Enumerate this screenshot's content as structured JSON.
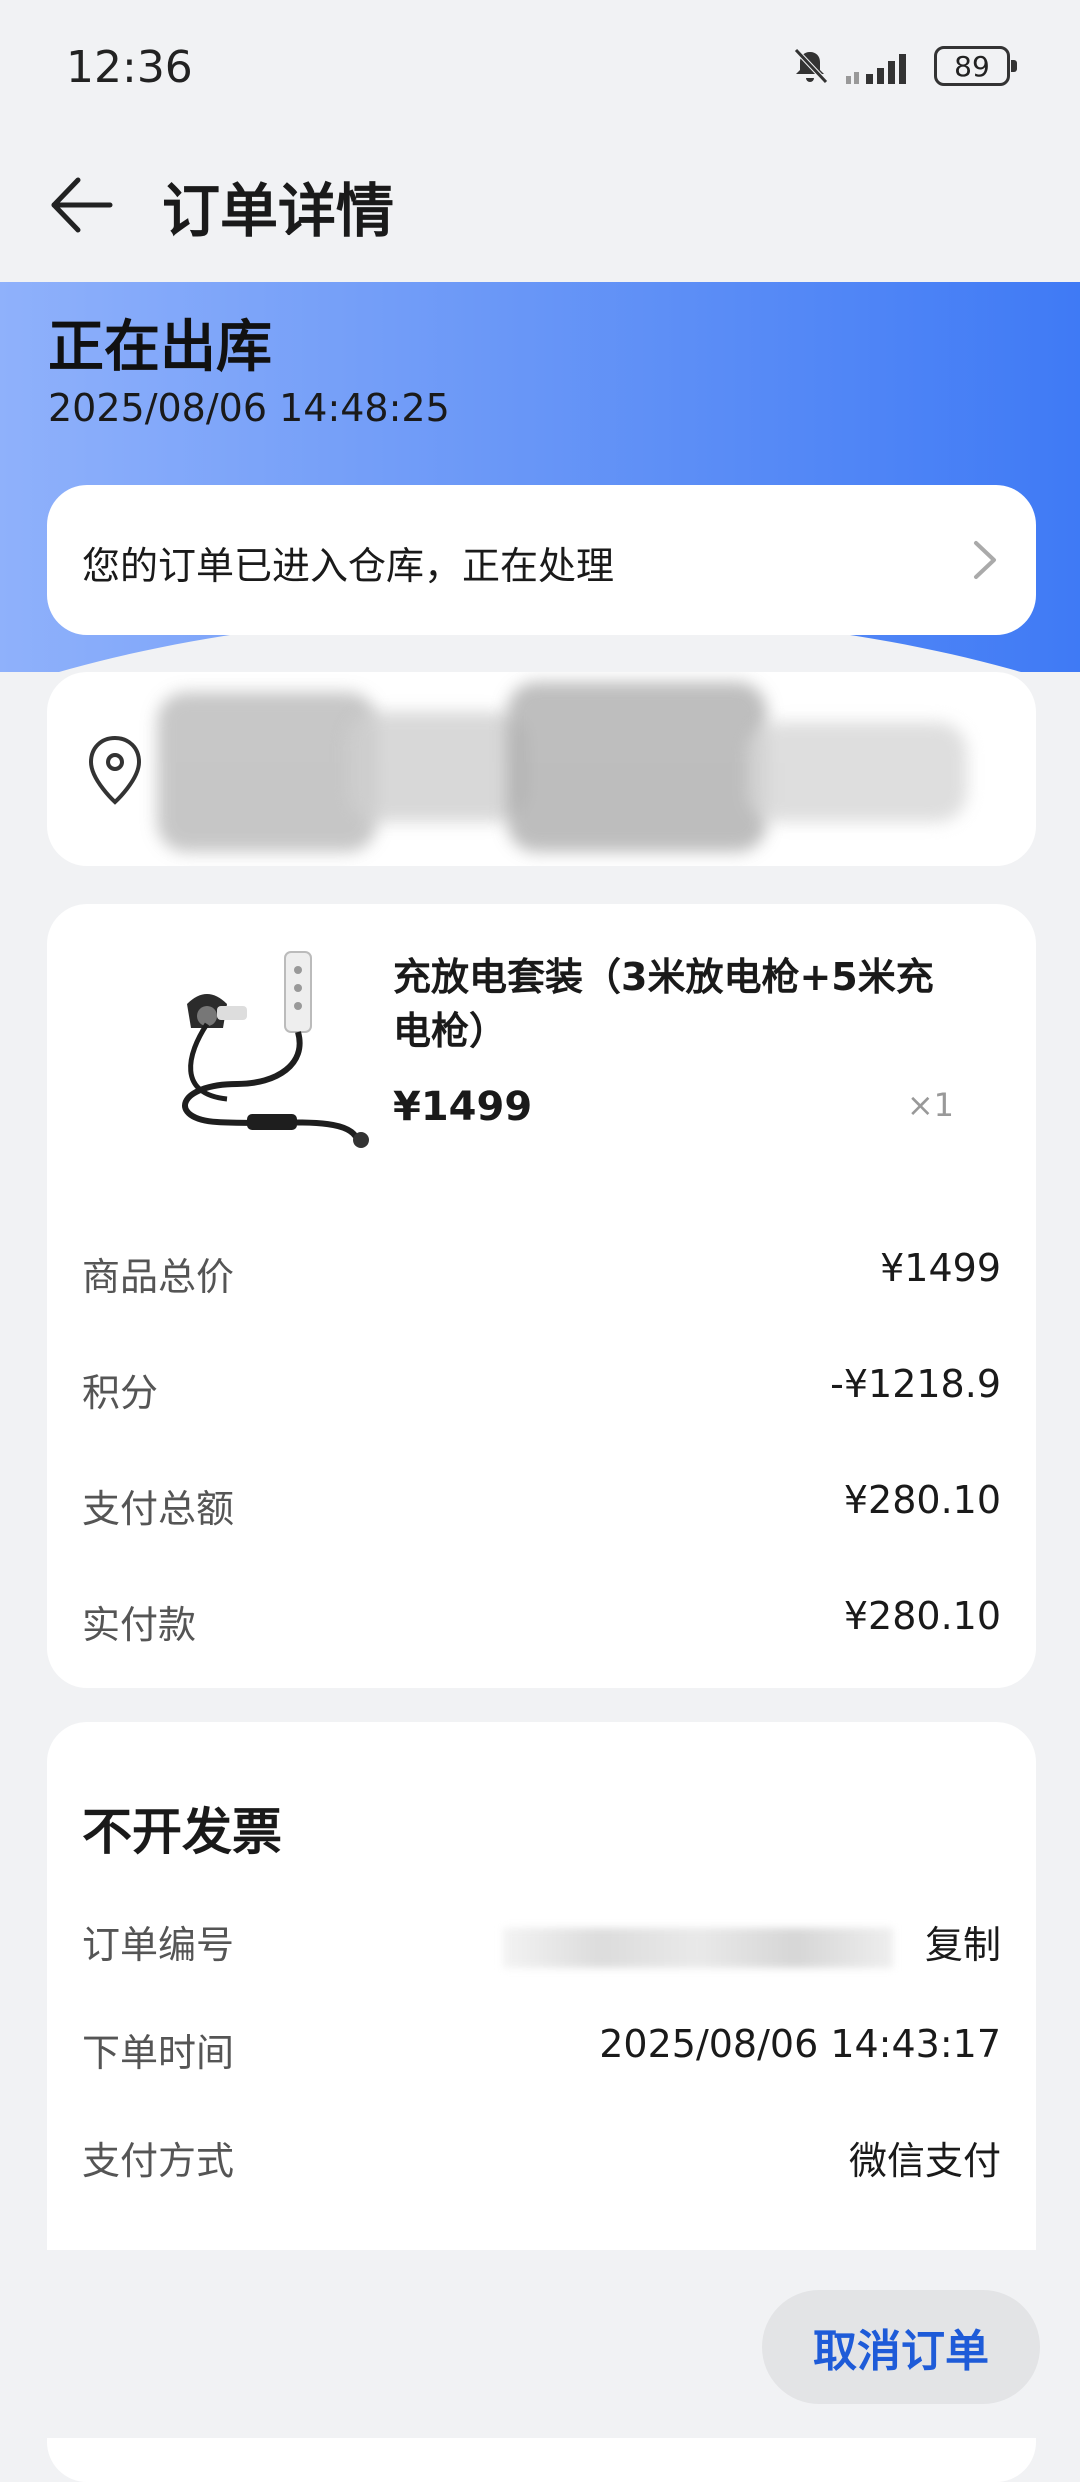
{
  "status_bar": {
    "time": "12:36",
    "battery": "89"
  },
  "header": {
    "title": "订单详情"
  },
  "shipping": {
    "status": "正在出库",
    "timestamp": "2025/08/06 14:48:25"
  },
  "notice": {
    "text": "您的订单已进入仓库，正在处理"
  },
  "address": {
    "line1": "",
    "line2": ""
  },
  "product": {
    "name": "充放电套装（3米放电枪+5米充电枪）",
    "price": "¥1499",
    "quantity": "×1"
  },
  "price_summary": [
    {
      "label": "商品总价",
      "value": "¥1499"
    },
    {
      "label": "积分",
      "value": "-¥1218.9"
    },
    {
      "label": "支付总额",
      "value": "¥280.10"
    },
    {
      "label": "实付款",
      "value": "¥280.10"
    }
  ],
  "order_info": {
    "invoice": "不开发票",
    "order_number_label": "订单编号",
    "copy_label": "复制",
    "order_time_label": "下单时间",
    "order_time": "2025/08/06 14:43:17",
    "payment_label": "支付方式",
    "payment_method": "微信支付"
  },
  "actions": {
    "cancel_order": "取消订单"
  },
  "colors": {
    "accent": "#1e5bd8",
    "banner_start": "#8fb1fb",
    "banner_end": "#3f7af5",
    "background": "#f1f2f4"
  }
}
